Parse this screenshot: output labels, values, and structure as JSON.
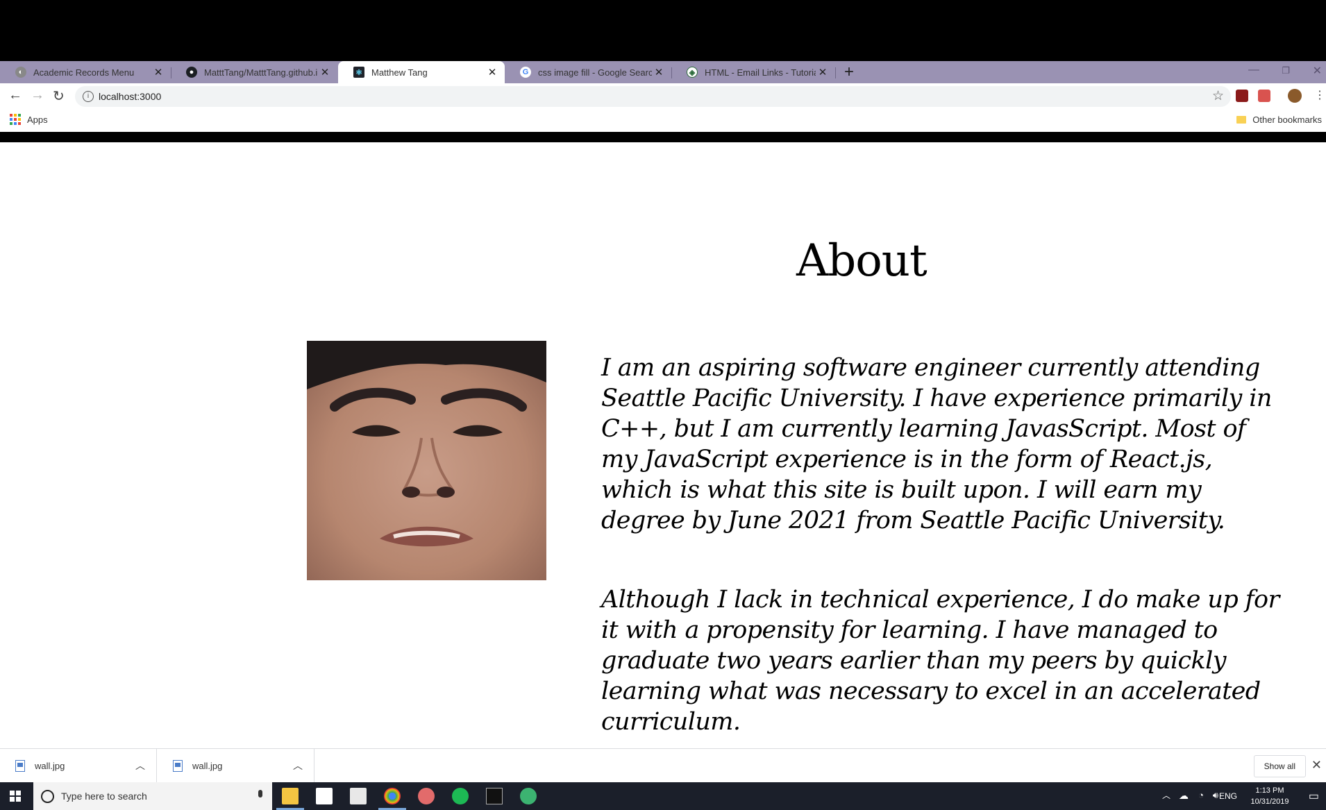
{
  "browser": {
    "tabs": [
      {
        "title": "Academic Records Menu",
        "active": false,
        "favicon": "globe-icon"
      },
      {
        "title": "MatttTang/MatttTang.github.io",
        "active": false,
        "favicon": "github-icon"
      },
      {
        "title": "Matthew Tang",
        "active": true,
        "favicon": "react-icon"
      },
      {
        "title": "css image fill - Google Search",
        "active": false,
        "favicon": "google-icon"
      },
      {
        "title": "HTML - Email Links - Tutorialspoi",
        "active": false,
        "favicon": "tutorialspoint-icon"
      }
    ],
    "new_tab_symbol": "+",
    "close_symbol": "✕",
    "url": "localhost:3000",
    "bookmarks": {
      "apps_label": "Apps",
      "other_label": "Other bookmarks"
    }
  },
  "page": {
    "heading": "About",
    "photo_alt": "portrait-photo",
    "paragraphs": [
      "I am an aspiring software engineer currently attending Seattle Pacific University. I have experience primarily in C++, but I am currently learning JavasScript. Most of my JavaScript experience is in the form of React.js, which is what this site is built upon. I will earn my degree by June 2021 from Seattle Pacific University.",
      "Although I lack in technical experience, I do make up for it with a propensity for learning. I have managed to graduate two years earlier than my peers by quickly learning what was necessary to excel in an accelerated curriculum."
    ]
  },
  "downloads": {
    "items": [
      {
        "name": "wall.jpg"
      },
      {
        "name": "wall.jpg"
      }
    ],
    "show_all_label": "Show all"
  },
  "taskbar": {
    "search_placeholder": "Type here to search",
    "language": "ENG",
    "time": "1:13 PM",
    "date": "10/31/2019",
    "pinned_apps": [
      "file-explorer-icon",
      "store-icon",
      "mail-icon",
      "chrome-icon",
      "snipping-icon",
      "spotify-icon",
      "terminal-icon",
      "app-icon"
    ]
  },
  "colors": {
    "tabstrip": "#9a92b3",
    "page_background": "#ffffff",
    "taskbar": "#1b1f2a"
  }
}
